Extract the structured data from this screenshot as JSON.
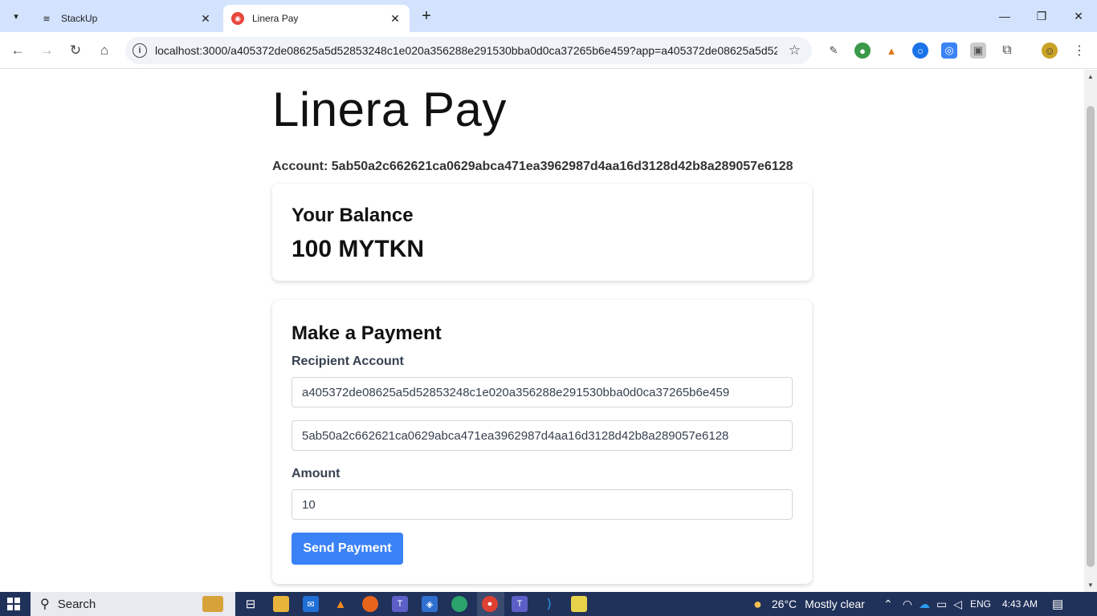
{
  "browser": {
    "tabs": [
      {
        "title": "StackUp",
        "close": "✕"
      },
      {
        "title": "Linera Pay",
        "close": "✕"
      }
    ],
    "new_tab": "+",
    "address": "localhost:3000/a405372de08625a5d52853248c1e020a356288e291530bba0d0ca37265b6e459?app=a405372de08625a5d528..."
  },
  "page": {
    "title": "Linera Pay",
    "account_line": "Account: 5ab50a2c662621ca0629abca471ea3962987d4aa16d3128d42b8a289057e6128",
    "balance": {
      "heading": "Your Balance",
      "amount": "100 MYTKN"
    },
    "payment": {
      "heading": "Make a Payment",
      "recipient_label": "Recipient Account",
      "recipient_chain_value": "a405372de08625a5d52853248c1e020a356288e291530bba0d0ca37265b6e459",
      "recipient_owner_value": "5ab50a2c662621ca0629abca471ea3962987d4aa16d3128d42b8a289057e6128",
      "amount_label": "Amount",
      "amount_value": "10",
      "send_label": "Send Payment"
    }
  },
  "taskbar": {
    "search_label": "Search",
    "weather_temp": "26°C",
    "weather_text": "Mostly clear",
    "language": "ENG",
    "time": "4:43 AM"
  },
  "colors": {
    "send_button": "#3b82f6",
    "tabstrip": "#d3e3fd",
    "taskbar": "#20315a"
  }
}
